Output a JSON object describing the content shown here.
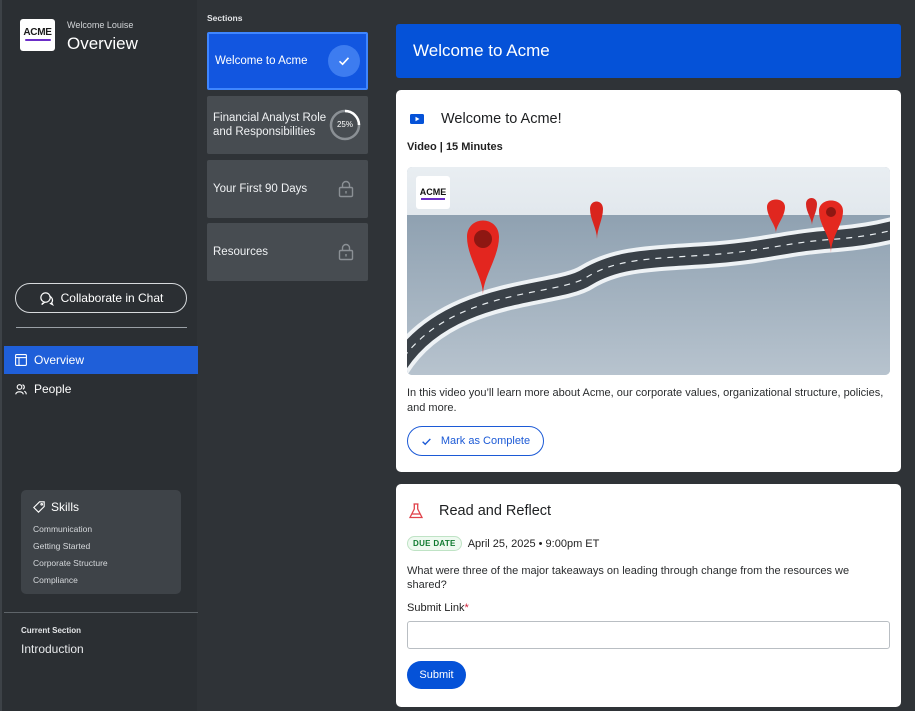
{
  "sidebar": {
    "logo_text": "ACME",
    "welcome": "Welcome Louise",
    "title": "Overview",
    "collaborate_label": "Collaborate in Chat",
    "nav": [
      {
        "label": "Overview",
        "icon": "layout-icon",
        "active": true
      },
      {
        "label": "People",
        "icon": "people-icon",
        "active": false
      }
    ],
    "skills": {
      "title": "Skills",
      "items": [
        "Communication",
        "Getting Started",
        "Corporate Structure",
        "Compliance"
      ]
    },
    "current_section_label": "Current Section",
    "current_section_value": "Introduction"
  },
  "sections": {
    "label": "Sections",
    "items": [
      {
        "label": "Welcome to Acme",
        "status": "complete"
      },
      {
        "label": "Financial Analyst Role and Responsibilities",
        "status": "in-progress",
        "progress_text": "25%",
        "progress": 0.25
      },
      {
        "label": "Your First 90 Days",
        "status": "locked"
      },
      {
        "label": "Resources",
        "status": "locked"
      }
    ]
  },
  "main": {
    "banner_title": "Welcome to Acme",
    "video_card": {
      "title": "Welcome to Acme!",
      "meta": "Video | 15 Minutes",
      "thumbnail_logo": "ACME",
      "description": "In this video you’ll learn more about Acme, our corporate values, organizational structure, policies, and more.",
      "complete_label": "Mark as Complete"
    },
    "reflect_card": {
      "title": "Read and Reflect",
      "due_badge": "DUE DATE",
      "due_date": "April 25, 2025 • 9:00pm ET",
      "question": "What were three of the major takeaways on leading through change from the resources we shared?",
      "submit_label": "Submit Link",
      "required_mark": "*",
      "input_value": "",
      "input_placeholder": "",
      "submit_button": "Submit"
    }
  },
  "colors": {
    "accent": "#0552d8",
    "sidebar_bg": "#2b2f33",
    "active_nav": "#1f5fd9",
    "due_green": "#0f7a2f",
    "required_red": "#d0223a"
  }
}
